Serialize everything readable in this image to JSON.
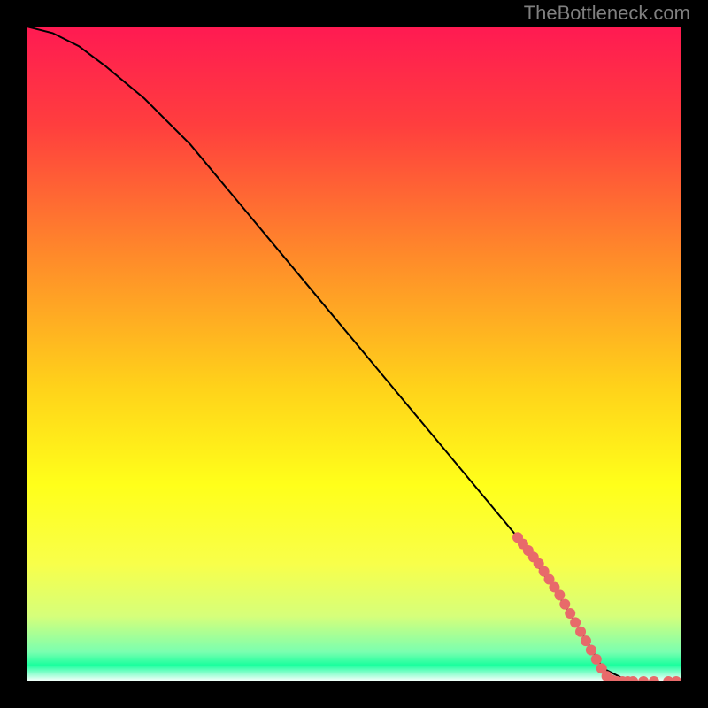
{
  "watermark": "TheBottleneck.com",
  "chart_data": {
    "type": "line",
    "title": "",
    "xlabel": "",
    "ylabel": "",
    "xlim": [
      0,
      100
    ],
    "ylim": [
      0,
      100
    ],
    "background_gradient_stops": [
      {
        "offset": 0.0,
        "color": "#ff1a52"
      },
      {
        "offset": 0.15,
        "color": "#ff3e3e"
      },
      {
        "offset": 0.35,
        "color": "#ff8a2a"
      },
      {
        "offset": 0.55,
        "color": "#ffd21a"
      },
      {
        "offset": 0.7,
        "color": "#ffff1a"
      },
      {
        "offset": 0.82,
        "color": "#f8ff4a"
      },
      {
        "offset": 0.9,
        "color": "#d6ff7a"
      },
      {
        "offset": 0.955,
        "color": "#7affb0"
      },
      {
        "offset": 0.975,
        "color": "#1aff9e"
      },
      {
        "offset": 1.0,
        "color": "#ffffff"
      }
    ],
    "curve": {
      "x": [
        0,
        4,
        8,
        12,
        18,
        25,
        35,
        45,
        55,
        65,
        75,
        82,
        85,
        88,
        92,
        96,
        100
      ],
      "y": [
        100,
        99,
        97,
        94,
        89,
        82,
        70,
        58,
        46,
        34,
        22,
        12,
        7,
        2,
        0,
        0,
        0
      ]
    },
    "highlight_points": [
      {
        "x": 75.0,
        "y": 22.0
      },
      {
        "x": 75.8,
        "y": 21.0
      },
      {
        "x": 76.6,
        "y": 20.0
      },
      {
        "x": 77.4,
        "y": 19.0
      },
      {
        "x": 78.2,
        "y": 18.0
      },
      {
        "x": 79.0,
        "y": 16.8
      },
      {
        "x": 79.8,
        "y": 15.6
      },
      {
        "x": 80.6,
        "y": 14.4
      },
      {
        "x": 81.4,
        "y": 13.2
      },
      {
        "x": 82.2,
        "y": 11.8
      },
      {
        "x": 83.0,
        "y": 10.4
      },
      {
        "x": 83.8,
        "y": 9.0
      },
      {
        "x": 84.6,
        "y": 7.6
      },
      {
        "x": 85.4,
        "y": 6.2
      },
      {
        "x": 86.2,
        "y": 4.8
      },
      {
        "x": 87.0,
        "y": 3.4
      },
      {
        "x": 87.8,
        "y": 2.0
      },
      {
        "x": 88.6,
        "y": 0.8
      },
      {
        "x": 89.4,
        "y": 0.2
      },
      {
        "x": 90.2,
        "y": 0.0
      },
      {
        "x": 91.0,
        "y": 0.0
      },
      {
        "x": 91.8,
        "y": 0.0
      },
      {
        "x": 92.6,
        "y": 0.0
      },
      {
        "x": 94.2,
        "y": 0.0
      },
      {
        "x": 95.8,
        "y": 0.0
      },
      {
        "x": 98.0,
        "y": 0.0
      },
      {
        "x": 99.2,
        "y": 0.0
      }
    ],
    "highlight_color": "#e86a6a",
    "highlight_radius": 6
  }
}
